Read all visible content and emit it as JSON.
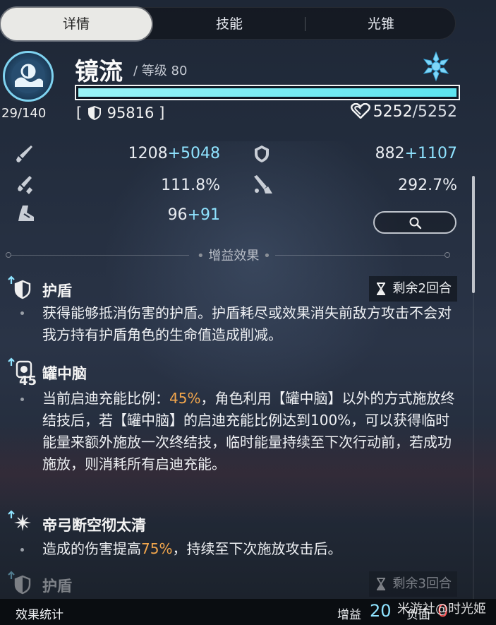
{
  "tabs": [
    {
      "label": "详情",
      "active": true
    },
    {
      "label": "技能",
      "active": false
    },
    {
      "label": "光锥",
      "active": false
    }
  ],
  "character": {
    "name": "镜流",
    "level_text": "/ 等级 80",
    "level_progress": "29/140",
    "shield_value": "95816",
    "shield_bracket_left": "[",
    "shield_bracket_right": "]",
    "hp_current": "5252",
    "hp_sep": "/",
    "hp_max": "5252",
    "hp_fraction": 1.0,
    "element_icon": "ice-snowflake-icon"
  },
  "stats": {
    "atk_base": "1208",
    "atk_bonus": "+5048",
    "def_base": "882",
    "def_bonus": "+1107",
    "crit_rate": "111.8%",
    "crit_dmg": "292.7%",
    "spd_base": "96",
    "spd_bonus": "+91"
  },
  "section": {
    "buffs_title": "增益效果"
  },
  "buffs": [
    {
      "name": "护盾",
      "remaining": "剩余2回合",
      "desc": "获得能够抵消伤害的护盾。护盾耗尽或效果消失前敌方攻击不会对我方持有护盾角色的生命值造成削减。"
    },
    {
      "name": "罐中脑",
      "stack": "45",
      "desc_parts": [
        "当前启迪充能比例：",
        "45%",
        "，角色利用【罐中脑】以外的方式施放终结技后，若【罐中脑】的启迪充能比例达到100%，可以获得临时能量来额外施放一次终结技，临时能量持续至下次行动前，若成功施放，则消耗所有启迪充能。"
      ]
    },
    {
      "name": "帝弓断空彻太清",
      "desc_parts": [
        "造成的伤害提高",
        "75%",
        "，持续至下次施放攻击后。"
      ]
    },
    {
      "name": "护盾",
      "remaining": "剩余3回合"
    }
  ],
  "footer": {
    "stats_label": "效果统计",
    "buff_label": "增益",
    "buff_count": "20",
    "debuff_label": "负面",
    "debuff_count": "0",
    "watermark": "米游社@时光姬"
  },
  "colors": {
    "accent_cyan": "#8fe3ff",
    "highlight_orange": "#f2a64c",
    "debuff_red": "#ff5a5a"
  }
}
